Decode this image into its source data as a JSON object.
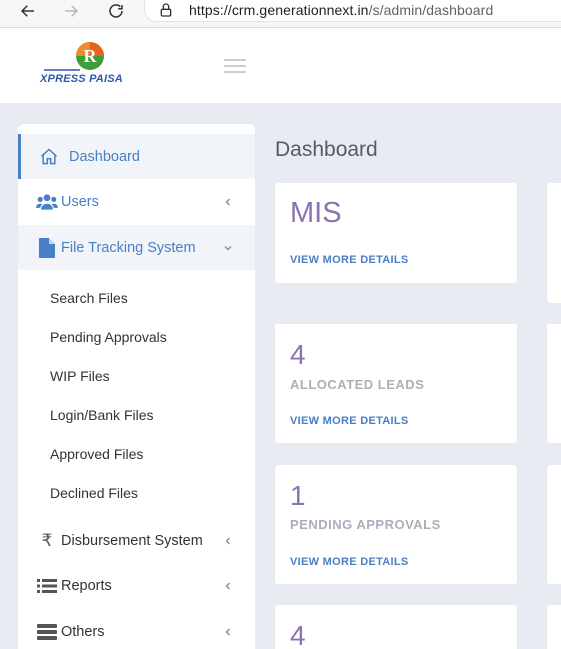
{
  "browser": {
    "url_host": "https://crm.generationnext.in",
    "url_path": "/s/admin/dashboard"
  },
  "header": {
    "logo_text": "XPRESS PAISA",
    "logo_letter": "R"
  },
  "sidebar": {
    "items": [
      {
        "label": "Dashboard",
        "icon": "home-icon"
      },
      {
        "label": "Users",
        "icon": "users-icon"
      },
      {
        "label": "File Tracking System",
        "icon": "file-icon"
      },
      {
        "label": "Disbursement System",
        "icon": "rupee-icon"
      },
      {
        "label": "Reports",
        "icon": "list-icon"
      },
      {
        "label": "Others",
        "icon": "server-icon"
      }
    ],
    "file_submenu": [
      "Search Files",
      "Pending Approvals",
      "WIP Files",
      "Login/Bank Files",
      "Approved Files",
      "Declined Files"
    ]
  },
  "main": {
    "title": "Dashboard",
    "cards": [
      {
        "value": "MIS",
        "caption": "",
        "link": "VIEW MORE DETAILS"
      },
      {
        "value": "4",
        "caption": "ALLOCATED LEADS",
        "link": "VIEW MORE DETAILS"
      },
      {
        "value": "1",
        "caption": "PENDING APPROVALS",
        "link": "VIEW MORE DETAILS"
      },
      {
        "value": "4",
        "caption": "",
        "link": ""
      }
    ]
  },
  "colors": {
    "accent": "#4a7ec6",
    "metric": "#8a73b0",
    "background": "#e9ebf3"
  }
}
